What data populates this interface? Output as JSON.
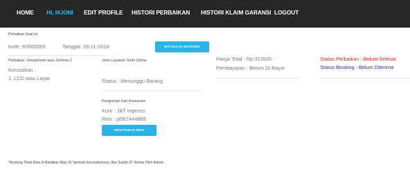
{
  "nav": {
    "home": "HOME",
    "user": "HI, MJONI",
    "edit_profile": "EDIT PROFILE",
    "histori_perbaikan": "HISTORI PERBAIKAN",
    "histori_klaim": "HISTORI KLAIM GARANSI",
    "logout": "LOGOUT"
  },
  "section_title": "Perbaikan Saat Ini",
  "booking": {
    "kode": "kode: K0000009",
    "tanggal": "Tanggal: 28-11-2018",
    "cancel_button": "BATALKAN BOOKING"
  },
  "perbaikan": {
    "device": "Perbaikan: Smartphone asus Zenfone 2",
    "kerusakan_label": "Kerusakan :",
    "kerusakan_item": "1. LCD atau Layar"
  },
  "layanan": {
    "label": "Jenis Layanan: Kirim Online",
    "status": "Status : Menunggu Barang"
  },
  "pembayaran": {
    "harga": "Harga Total : Rp.313500 -",
    "status": "Pembayaran : Belum Di Bayar"
  },
  "status": {
    "perbaikan": "Status Perbaikan : Belum Selesai",
    "booking": "Status Booking : Belum Diterima"
  },
  "pengiriman": {
    "title": "Pengiriman Dari Konsumen",
    "kurir": "Kurir : J&T express",
    "resi": "Resi : jd567444889",
    "button": "INPUT/UBAH RESI"
  },
  "footnote": "*Booking Tidak Bisa di Batalkan Atau Di Tambah Kerusakannya Jika Sudah Di Terima Oleh Admin",
  "colors": {
    "nav_bg": "#262626",
    "accent": "#29b4e8",
    "status_red": "#e02020",
    "status_blue": "#2233bb"
  }
}
